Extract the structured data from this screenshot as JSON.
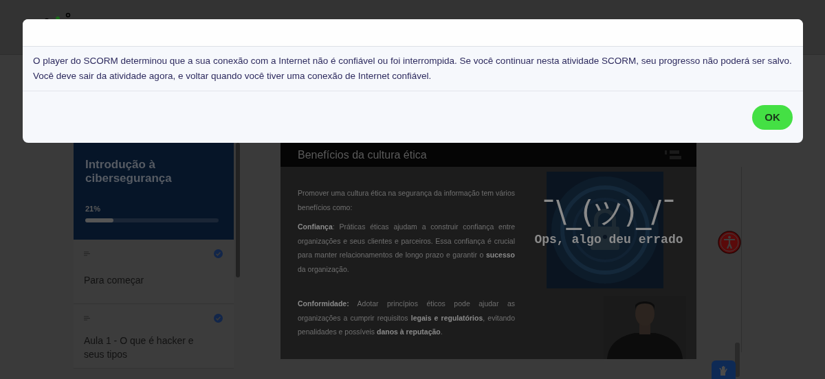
{
  "dialog": {
    "message": [
      "O player do SCORM determinou que a sua conexão com a Internet não é confiável ou foi interrompida. Se você continuar nesta atividade SCORM, seu progresso não poderá ser salvo.",
      "Você deve sair da atividade agora, e voltar quando você tiver uma conexão de Internet confiável."
    ],
    "ok_button": "OK"
  },
  "course": {
    "title": "Introdução à cibersegurança",
    "progress_label": "21%",
    "level": 0.21
  },
  "lessons": [
    {
      "title": "Para começar",
      "completed": true
    },
    {
      "title": "Aula 1 - O que é hacker e seus tipos",
      "completed": true
    }
  ],
  "slide": {
    "title": "Benefícios da cultura ética",
    "paragraphs": [
      "Promover uma cultura ética na segurança da informação tem vários benefícios como:",
      "**Confiança**: Práticas éticas ajudam a construir confiança entre organizações e seus clientes e parceiros. Essa confiança é crucial para manter relacionamentos de longo prazo e garantir o **sucesso** da organização.",
      "**Conformidade:** Adotar princípios éticos pode ajudar as organizações a cumprir requisitos **legais e regulatórios**, evitando penalidades e possíveis **danos à reputação**."
    ]
  },
  "error": {
    "emoticon": "¯\\_(ツ)_/¯",
    "message": "Ops, algo deu errado"
  }
}
